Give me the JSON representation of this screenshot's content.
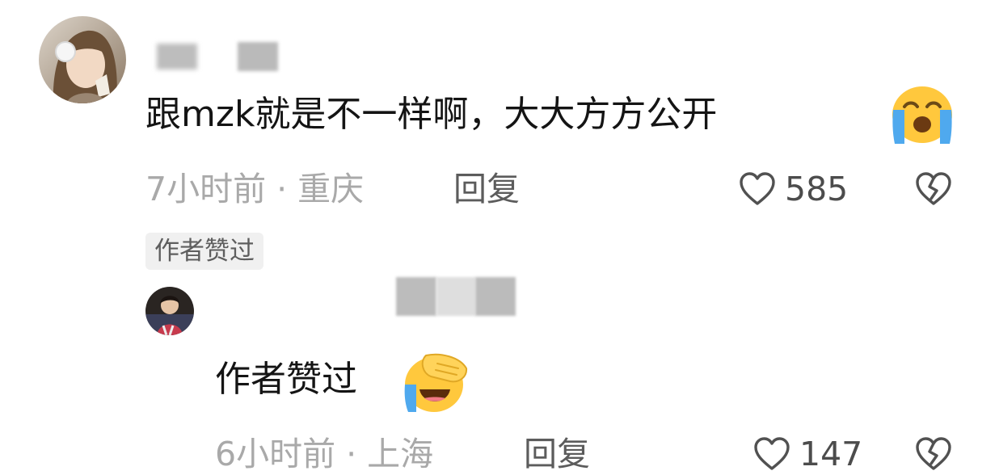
{
  "comment": {
    "text": "跟mzk就是不一样啊，大大方方公开",
    "emoji": "crying-face",
    "time_location": "7小时前 · 重庆",
    "reply_label": "回复",
    "like_count": "585",
    "author_liked_badge": "作者赞过"
  },
  "reply": {
    "text": "作者赞过",
    "emoji": "facepalm-laughing-crying",
    "time_location": "6小时前 · 上海",
    "reply_label": "回复",
    "like_count": "147"
  },
  "icons": {
    "like": "heart-outline-icon",
    "dislike": "broken-heart-outline-icon"
  },
  "colors": {
    "meta_text": "#a9a9a9",
    "badge_bg": "#f0f0f0",
    "emoji_yellow": "#ffc83d",
    "emoji_tear": "#4fa9ee"
  }
}
